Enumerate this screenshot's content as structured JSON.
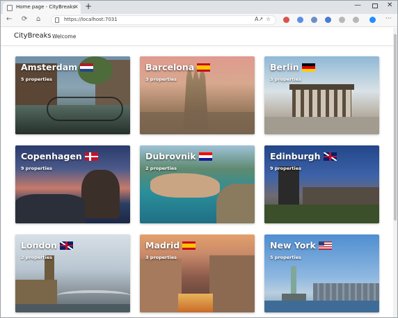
{
  "browser": {
    "tab_title": "Home page - CityBreaks",
    "tab_close": "×",
    "new_tab": "+",
    "url": "https://localhost:7031",
    "back_icon": "←",
    "reload_icon": "⟳",
    "home_icon": "⌂",
    "info_icon": "ⓘ",
    "read_aloud_icon": "A↗",
    "favorites_icon": "☆",
    "more_icon": "···",
    "minimize_icon": "—",
    "close_icon": "✕"
  },
  "site": {
    "brand": "CityBreaks",
    "nav_welcome": "Welcome"
  },
  "cities": [
    {
      "name": "Amsterdam",
      "properties": "5 properties",
      "flag": "nl"
    },
    {
      "name": "Barcelona",
      "properties": "3 properties",
      "flag": "es"
    },
    {
      "name": "Berlin",
      "properties": "3 properties",
      "flag": "de"
    },
    {
      "name": "Copenhagen",
      "properties": "9 properties",
      "flag": "dk"
    },
    {
      "name": "Dubrovnik",
      "properties": "2 properties",
      "flag": "hr"
    },
    {
      "name": "Edinburgh",
      "properties": "9 properties",
      "flag": "gb"
    },
    {
      "name": "London",
      "properties": "2 properties",
      "flag": "gb"
    },
    {
      "name": "Madrid",
      "properties": "3 properties",
      "flag": "es"
    },
    {
      "name": "New York",
      "properties": "5 properties",
      "flag": "us"
    }
  ],
  "colors": {
    "tabstrip": "#dfe3e8",
    "toolbar": "#f7f7f7",
    "card_text": "#ffffff"
  }
}
